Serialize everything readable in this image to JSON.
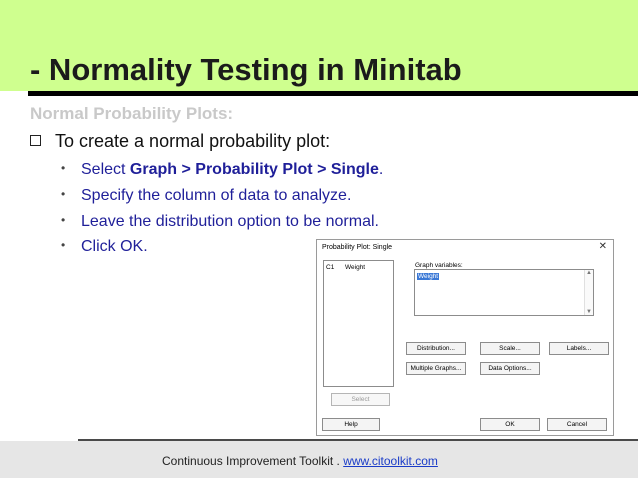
{
  "slide": {
    "title": "- Normality Testing in Minitab",
    "section_heading": "Normal Probability Plots:",
    "main_bullet": "To create a normal probability plot:",
    "sub_bullets": [
      {
        "prefix": "Select ",
        "bold": "Graph > Probability Plot > Single",
        "suffix": "."
      },
      {
        "text": "Specify the column of data to analyze."
      },
      {
        "text": "Leave the distribution option to be normal."
      },
      {
        "text": "Click OK."
      }
    ]
  },
  "dialog": {
    "title": "Probability Plot: Single",
    "close_glyph": "✕",
    "variables": [
      {
        "column": "C1",
        "name": "Weight"
      }
    ],
    "graph_variables_label": "Graph variables:",
    "graph_variables_value": "Weight",
    "buttons": {
      "distribution": "Distribution...",
      "scale": "Scale...",
      "labels": "Labels...",
      "multiple_graphs": "Multiple Graphs...",
      "data_options": "Data Options...",
      "select": "Select",
      "help": "Help",
      "ok": "OK",
      "cancel": "Cancel"
    }
  },
  "footer": {
    "text": "Continuous Improvement Toolkit . ",
    "link": "www.citoolkit.com"
  },
  "colors": {
    "title_band": "#cfff8f",
    "bullet_text": "#1f1f99",
    "section_heading": "#c9c9c9",
    "footer_band": "#e6e6e6"
  }
}
